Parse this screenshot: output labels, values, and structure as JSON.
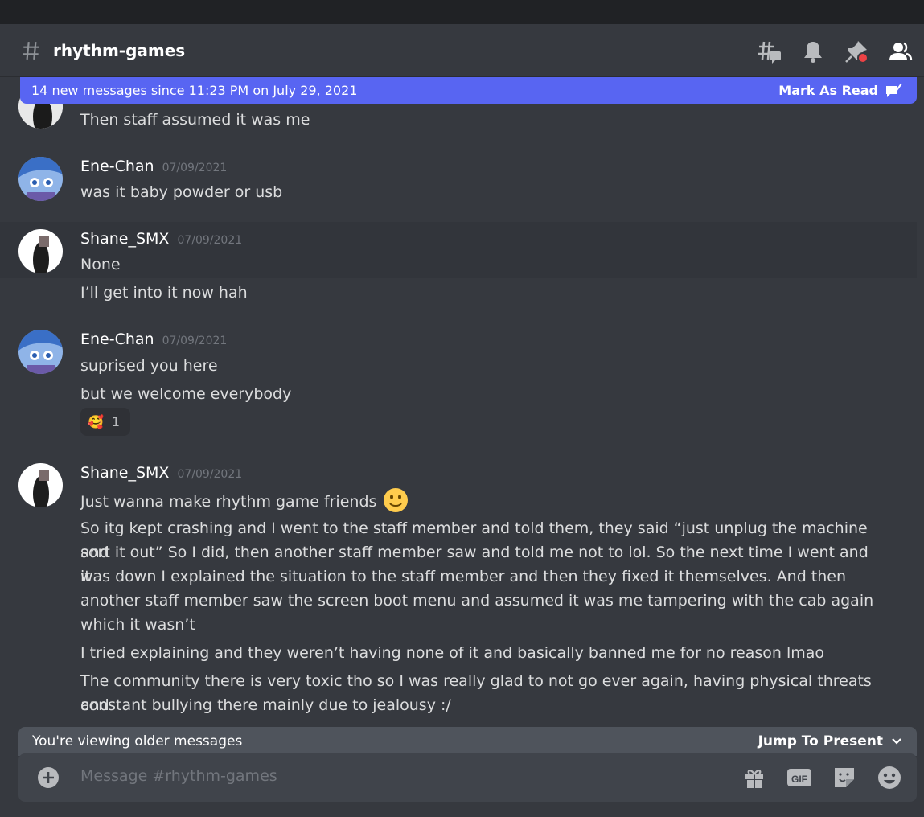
{
  "header": {
    "channel": "rhythm-games"
  },
  "new_banner": {
    "text": "14 new messages since 11:23 PM on July 29, 2021",
    "action": "Mark As Read"
  },
  "messages": [
    {
      "lines": [
        "Then staff assumed it was me"
      ]
    },
    {
      "author": "Ene-Chan",
      "timestamp": "07/09/2021",
      "lines": [
        "was it baby powder or usb"
      ]
    },
    {
      "author": "Shane_SMX",
      "timestamp": "07/09/2021",
      "lines": [
        "None",
        "I’ll get into it now hah"
      ]
    },
    {
      "author": "Ene-Chan",
      "timestamp": "07/09/2021",
      "lines": [
        "suprised you here",
        "but we welcome everybody"
      ],
      "reaction": {
        "emoji": "🥰",
        "count": "1"
      }
    },
    {
      "author": "Shane_SMX",
      "timestamp": "07/09/2021",
      "lines": [
        "Just wanna make rhythm game friends",
        "So itg kept crashing and I went to the staff member and told them, they said “just unplug the machine and",
        "sort it out” So I did, then another staff member saw and told me not to lol. So the next time I went and it",
        "was down I explained the situation to the staff member and then they fixed it themselves. And then",
        "another staff member saw the screen boot menu and assumed it was me tampering with the cab again",
        "which it wasn’t",
        "I tried explaining and they weren’t having none of it and basically banned me for no reason lmao",
        "The community there is very toxic tho so I was really glad to not go ever again, having physical threats and",
        "constant bullying there mainly due to jealousy :/"
      ]
    }
  ],
  "older_bar": {
    "text": "You're viewing older messages",
    "jump": "Jump To Present"
  },
  "composer": {
    "placeholder": "Message #rhythm-games"
  },
  "colors": {
    "accent": "#5865f2",
    "background": "#36393f",
    "unread_dot": "#ed4245"
  }
}
